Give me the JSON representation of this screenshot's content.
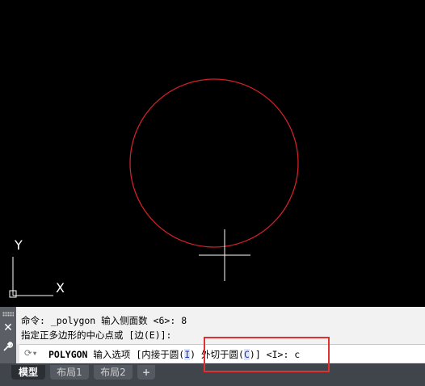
{
  "canvas": {
    "ucs_y_label": "Y",
    "ucs_x_label": "X"
  },
  "command_panel": {
    "history": [
      "命令: _polygon 输入侧面数 <6>: 8",
      "指定正多边形的中心点或 [边(E)]:"
    ],
    "input": {
      "command": "POLYGON",
      "prompt": "输入选项 [",
      "option1_label": "内接于圆(",
      "option1_key": "I",
      "option1_close": ")",
      "option2_label": "外切于圆(",
      "option2_key": "C",
      "option2_close": ")",
      "suffix": "] <I>: ",
      "typed_value": "c"
    }
  },
  "tabs": {
    "model": "模型",
    "layout1": "布局1",
    "layout2": "布局2",
    "add": "+"
  },
  "colors": {
    "circle": "#d0202a",
    "crosshair": "#ffffff",
    "highlight": "#e03030"
  }
}
